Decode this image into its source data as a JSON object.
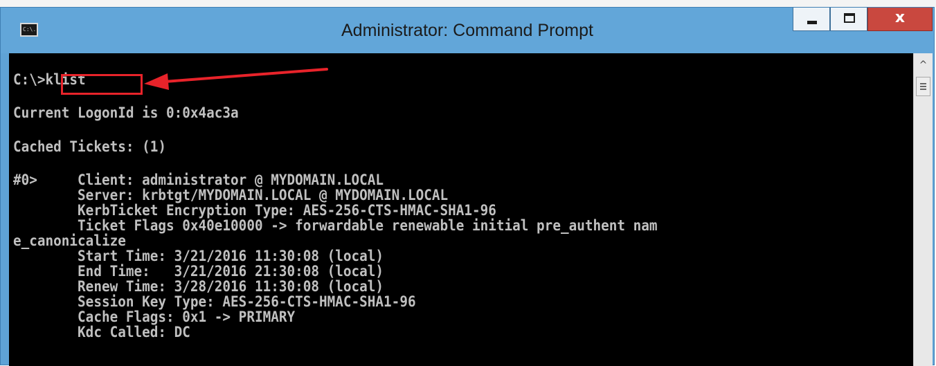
{
  "window": {
    "title": "Administrator: Command Prompt",
    "icon": "cmd-window-icon",
    "icon_text": "C:\\.",
    "controls": {
      "minimize": "minimize-icon",
      "maximize": "maximize-icon",
      "close": "x"
    }
  },
  "console": {
    "lines": [
      "C:\\>klist",
      "Current LogonId is 0:0x4ac3a",
      "Cached Tickets: (1)",
      "#0>     Client: administrator @ MYDOMAIN.LOCAL",
      "        Server: krbtgt/MYDOMAIN.LOCAL @ MYDOMAIN.LOCAL",
      "        KerbTicket Encryption Type: AES-256-CTS-HMAC-SHA1-96",
      "        Ticket Flags 0x40e10000 -> forwardable renewable initial pre_authent nam",
      "e_canonicalize",
      "        Start Time: 3/21/2016 11:30:08 (local)",
      "        End Time:   3/21/2016 21:30:08 (local)",
      "        Renew Time: 3/28/2016 11:30:08 (local)",
      "        Session Key Type: AES-256-CTS-HMAC-SHA1-96",
      "        Cache Flags: 0x1 -> PRIMARY",
      "        Kdc Called: DC"
    ]
  },
  "annotation": {
    "color": "#e8232a",
    "arrow": "red-arrow",
    "target": "klist command"
  },
  "scrollbar": {
    "up": "^"
  },
  "colors": {
    "titlebar": "#62a6d9",
    "console_bg": "#000000",
    "console_text": "#c0c0c0",
    "close_button": "#c9483f"
  }
}
